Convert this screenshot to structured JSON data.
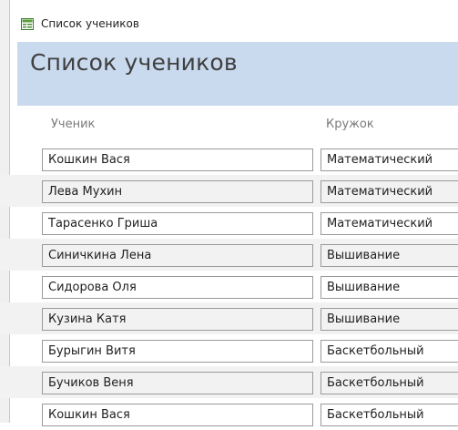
{
  "window": {
    "title": "Список учеников"
  },
  "form": {
    "title": "Список учеников"
  },
  "columns": {
    "student": "Ученик",
    "club": "Кружок"
  },
  "rows": [
    {
      "name": "Кошкин Вася",
      "club": "Математический"
    },
    {
      "name": "Лева Мухин",
      "club": "Математический"
    },
    {
      "name": "Тарасенко Гриша",
      "club": "Математический"
    },
    {
      "name": "Синичкина Лена",
      "club": "Вышивание"
    },
    {
      "name": "Сидорова Оля",
      "club": "Вышивание"
    },
    {
      "name": "Кузина Катя",
      "club": "Вышивание"
    },
    {
      "name": "Бурыгин Витя",
      "club": "Баскетбольный"
    },
    {
      "name": "Бучиков Веня",
      "club": "Баскетбольный"
    },
    {
      "name": "Кошкин Вася",
      "club": "Баскетбольный"
    }
  ],
  "colors": {
    "header_band": "#c9d9ee",
    "alt_row": "#f2f2f2",
    "border": "#9a9a9a"
  },
  "icons": {
    "window": "form-icon"
  }
}
